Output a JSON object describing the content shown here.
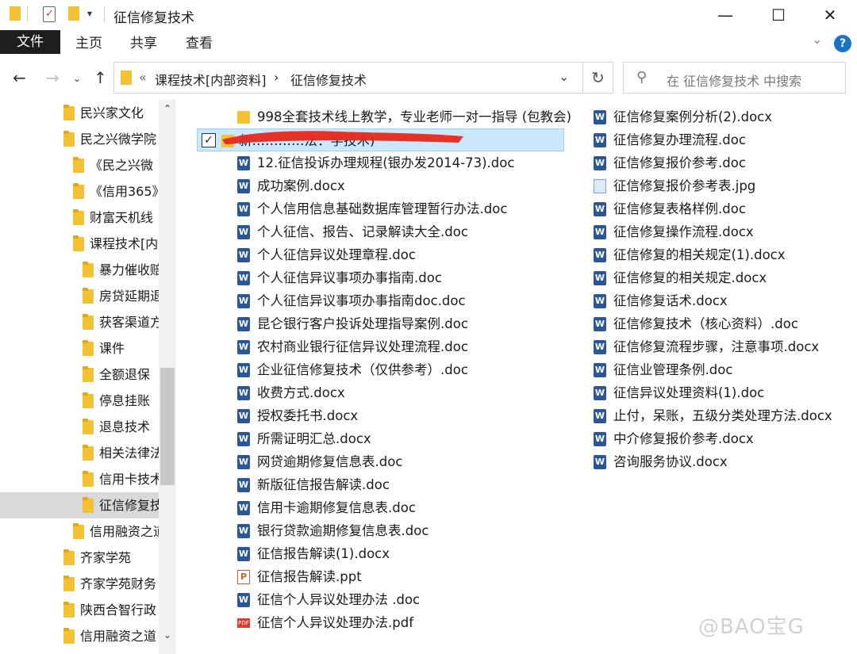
{
  "window": {
    "title": "征信修复技术",
    "minimize": "—",
    "maximize": "☐",
    "close": "✕"
  },
  "ribbon": {
    "tabs": [
      "文件",
      "主页",
      "共享",
      "查看"
    ]
  },
  "address": {
    "overflow": "«",
    "crumbs": [
      "课程技术[内部资料]",
      "征信修复技术"
    ],
    "separator": "›",
    "refresh": "↻"
  },
  "search": {
    "placeholder": "在 征信修复技术 中搜索"
  },
  "nav_pane": {
    "items": [
      {
        "label": "民兴家文化",
        "indent": 1
      },
      {
        "label": "民之兴微学院",
        "indent": 1
      },
      {
        "label": "《民之兴微",
        "indent": 2
      },
      {
        "label": "《信用365》",
        "indent": 2
      },
      {
        "label": "财富天机线",
        "indent": 2
      },
      {
        "label": "课程技术[内",
        "indent": 2
      },
      {
        "label": "暴力催收赔",
        "indent": 3
      },
      {
        "label": "房贷延期退",
        "indent": 3
      },
      {
        "label": "获客渠道方",
        "indent": 3
      },
      {
        "label": "课件",
        "indent": 3
      },
      {
        "label": "全额退保",
        "indent": 3
      },
      {
        "label": "停息挂账",
        "indent": 3
      },
      {
        "label": "退息技术",
        "indent": 3
      },
      {
        "label": "相关法律法",
        "indent": 3
      },
      {
        "label": "信用卡技术",
        "indent": 3
      },
      {
        "label": "征信修复技",
        "indent": 3,
        "selected": true
      },
      {
        "label": "信用融资之道",
        "indent": 2
      },
      {
        "label": "齐家学苑",
        "indent": 1
      },
      {
        "label": "齐家学苑财务",
        "indent": 1
      },
      {
        "label": "陕西合智行政",
        "indent": 1
      },
      {
        "label": "信用融资之道",
        "indent": 1
      }
    ]
  },
  "files_col1": [
    {
      "name": "998全套技术线上教学，专业老师一对一指导 (包教会)",
      "type": "folder"
    },
    {
      "name": "新…………法：学技术)",
      "type": "folder",
      "selected": true,
      "redacted": true
    },
    {
      "name": "12.征信投诉办理规程(银办发2014-73).doc",
      "type": "word"
    },
    {
      "name": "成功案例.docx",
      "type": "word"
    },
    {
      "name": "个人信用信息基础数据库管理暂行办法.doc",
      "type": "word"
    },
    {
      "name": "个人征信、报告、记录解读大全.doc",
      "type": "word"
    },
    {
      "name": "个人征信异议处理章程.doc",
      "type": "word"
    },
    {
      "name": "个人征信异议事项办事指南.doc",
      "type": "word"
    },
    {
      "name": "个人征信异议事项办事指南doc.doc",
      "type": "word"
    },
    {
      "name": "昆仑银行客户投诉处理指导案例.doc",
      "type": "word"
    },
    {
      "name": "农村商业银行征信异议处理流程.doc",
      "type": "word"
    },
    {
      "name": "企业征信修复技术（仅供参考）.doc",
      "type": "word"
    },
    {
      "name": "收费方式.docx",
      "type": "word"
    },
    {
      "name": "授权委托书.docx",
      "type": "word"
    },
    {
      "name": "所需证明汇总.docx",
      "type": "word"
    },
    {
      "name": "网贷逾期修复信息表.doc",
      "type": "word"
    },
    {
      "name": "新版征信报告解读.doc",
      "type": "word"
    },
    {
      "name": "信用卡逾期修复信息表.doc",
      "type": "word"
    },
    {
      "name": "银行贷款逾期修复信息表.doc",
      "type": "word"
    },
    {
      "name": "征信报告解读(1).docx",
      "type": "word"
    },
    {
      "name": "征信报告解读.ppt",
      "type": "ppt"
    },
    {
      "name": "征信个人异议处理办法 .doc",
      "type": "word"
    },
    {
      "name": "征信个人异议处理办法.pdf",
      "type": "pdf"
    }
  ],
  "files_col2": [
    {
      "name": "征信修复案例分析(2).docx",
      "type": "word"
    },
    {
      "name": "征信修复办理流程.doc",
      "type": "word"
    },
    {
      "name": "征信修复报价参考.doc",
      "type": "word"
    },
    {
      "name": "征信修复报价参考表.jpg",
      "type": "img"
    },
    {
      "name": "征信修复表格样例.doc",
      "type": "word"
    },
    {
      "name": "征信修复操作流程.docx",
      "type": "word"
    },
    {
      "name": "征信修复的相关规定(1).docx",
      "type": "word"
    },
    {
      "name": "征信修复的相关规定.docx",
      "type": "word"
    },
    {
      "name": "征信修复话术.docx",
      "type": "word"
    },
    {
      "name": "征信修复技术（核心资料）.doc",
      "type": "word"
    },
    {
      "name": "征信修复流程步骤，注意事项.docx",
      "type": "word"
    },
    {
      "name": "征信业管理条例.doc",
      "type": "word"
    },
    {
      "name": "征信异议处理资料(1).doc",
      "type": "word"
    },
    {
      "name": "止付，呆账，五级分类处理方法.docx",
      "type": "word"
    },
    {
      "name": "中介修复报价参考.docx",
      "type": "word"
    },
    {
      "name": "咨询服务协议.docx",
      "type": "word"
    }
  ],
  "watermark": "@BAO宝G",
  "colors": {
    "folder": "#f2c232",
    "word": "#2b5797",
    "selection": "#cce8ff",
    "nav_selected": "#d9d9d9",
    "help": "#1a73c9",
    "redaction": "#e8281c"
  }
}
